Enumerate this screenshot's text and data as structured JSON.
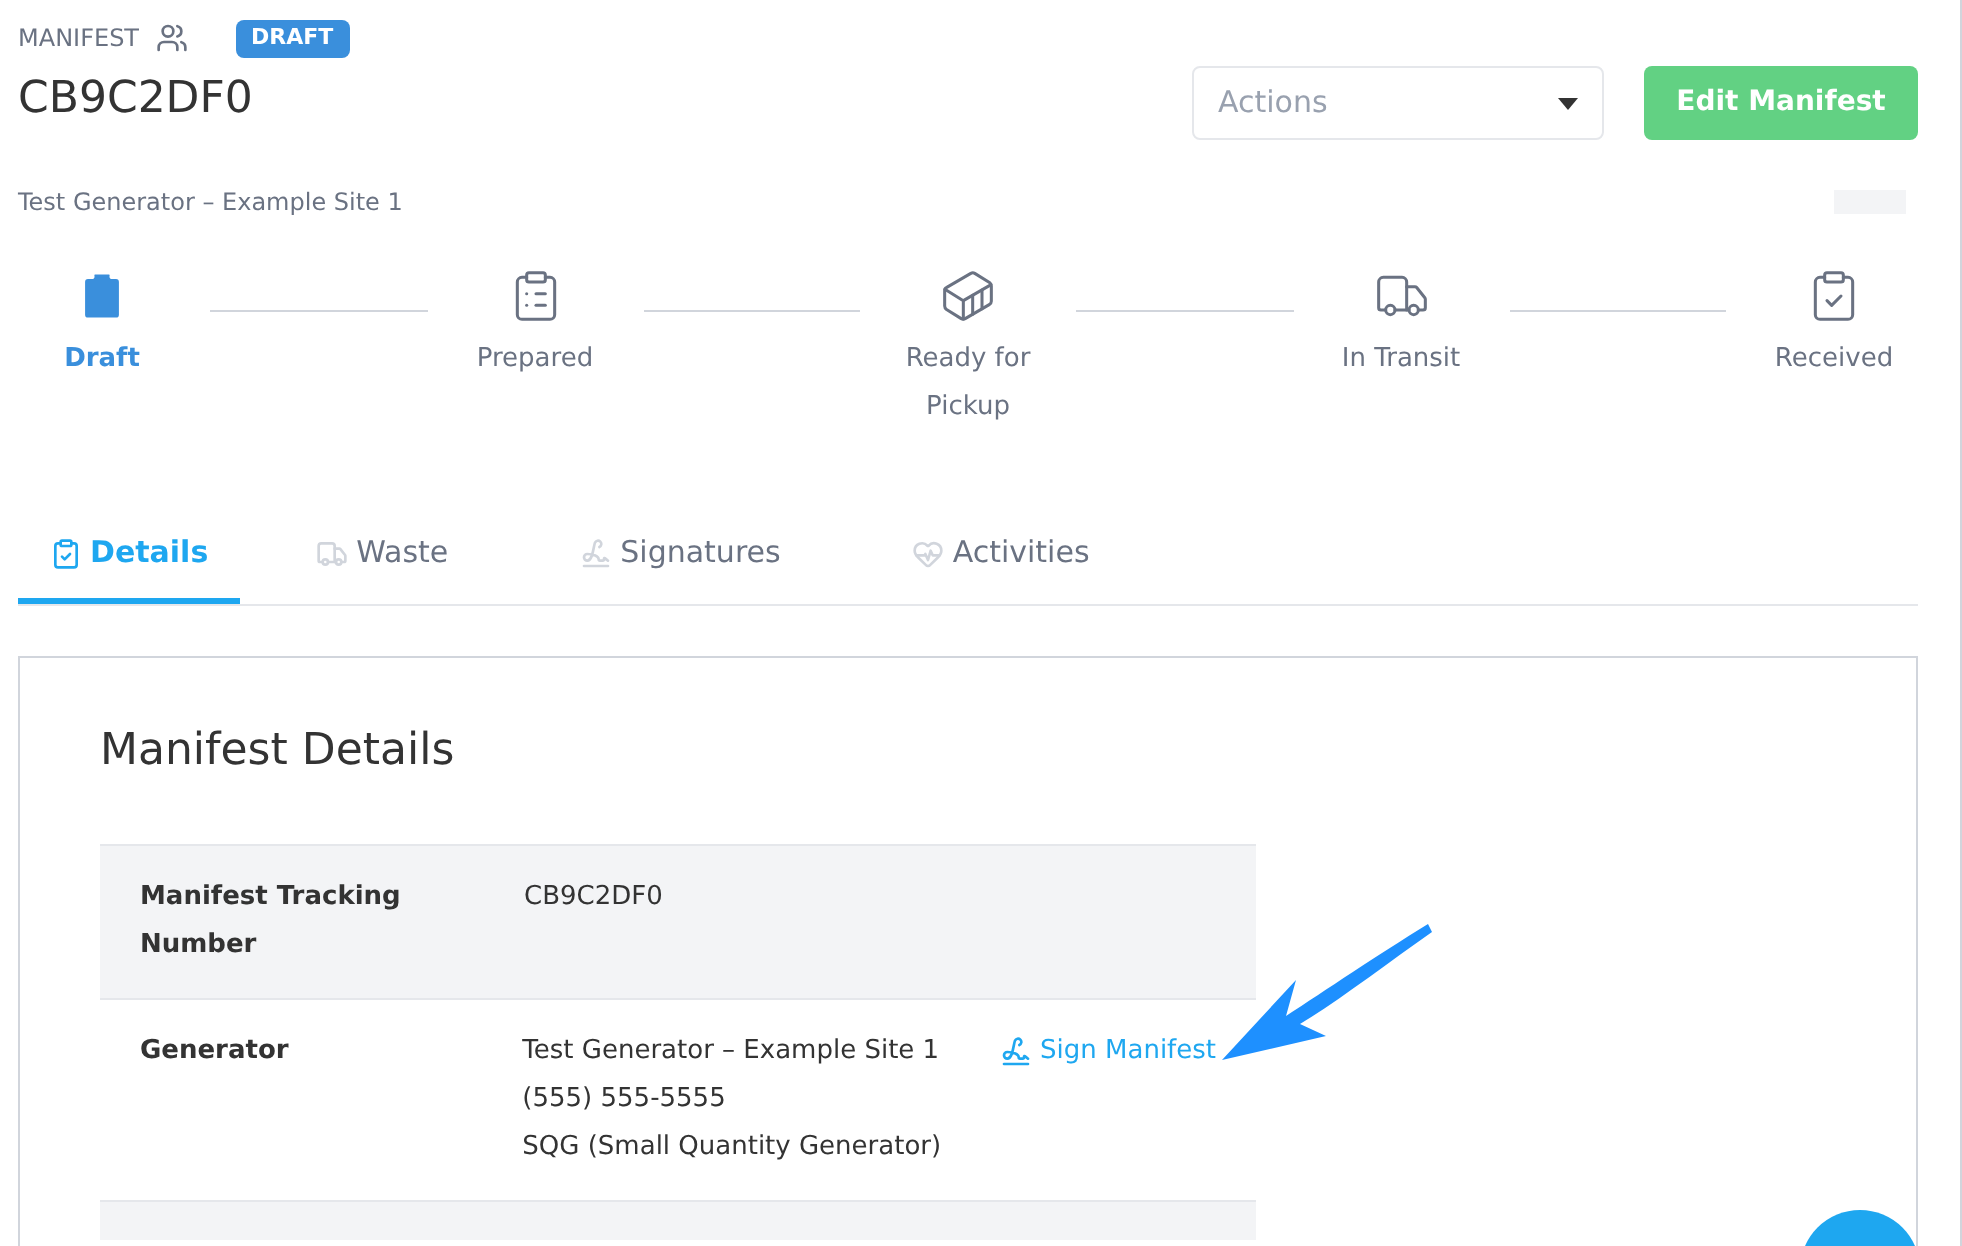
{
  "header": {
    "eyebrow": "MANIFEST",
    "status_badge": "DRAFT",
    "title": "CB9C2DF0",
    "subtitle": "Test Generator – Example Site 1"
  },
  "actions_select": {
    "placeholder": "Actions"
  },
  "edit_button": "Edit Manifest",
  "steps": [
    {
      "label": "Draft",
      "selected": true
    },
    {
      "label": "Prepared",
      "selected": false
    },
    {
      "label": "Ready for Pickup",
      "selected": false
    },
    {
      "label": "In Transit",
      "selected": false
    },
    {
      "label": "Received",
      "selected": false
    }
  ],
  "tabs": [
    {
      "label": "Details",
      "selected": true
    },
    {
      "label": "Waste",
      "selected": false
    },
    {
      "label": "Signatures",
      "selected": false
    },
    {
      "label": "Activities",
      "selected": false
    }
  ],
  "details": {
    "title": "Manifest Details",
    "rows": [
      {
        "label": "Manifest Tracking Number",
        "lines": [
          "CB9C2DF0"
        ]
      },
      {
        "label": "Generator",
        "lines": [
          "Test Generator – Example Site 1",
          "(555) 555-5555",
          "SQG (Small Quantity Generator)"
        ],
        "link": "Sign Manifest"
      }
    ]
  }
}
